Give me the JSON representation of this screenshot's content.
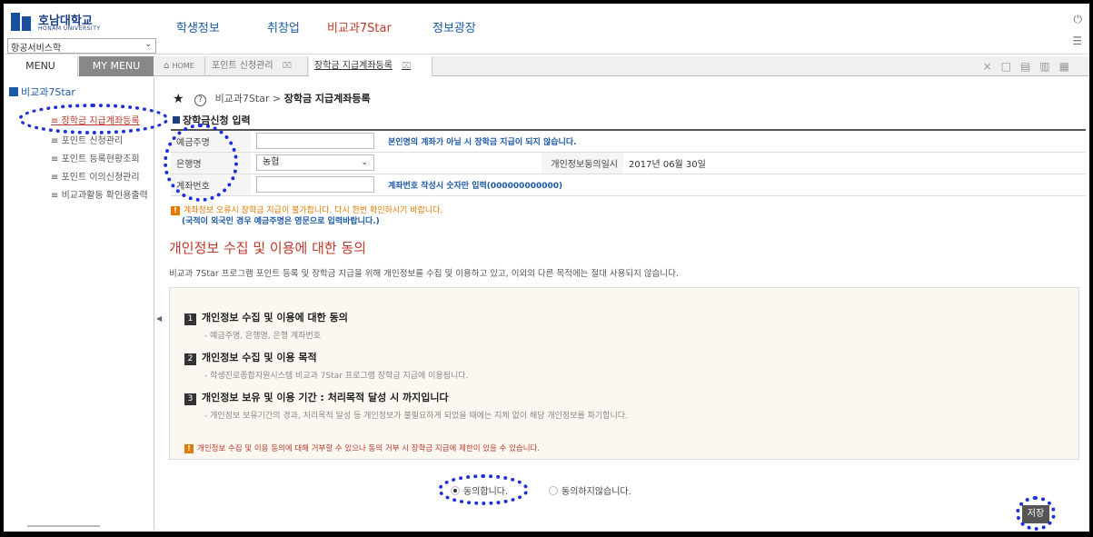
{
  "header": {
    "logo_name": "호남대학교",
    "logo_eng": "HONAM UNIVERSITY",
    "dept_value": "항공서비스학",
    "nav": [
      "학생정보",
      "취창업",
      "비교과7Star",
      "정보광장"
    ]
  },
  "tabs": {
    "menu": "MENU",
    "my_menu": "MY MENU",
    "home": "HOME",
    "tab1": "포인트 신청관리",
    "tab2": "장학금 지급계좌등록"
  },
  "sidebar": {
    "head": "비교과7Star",
    "items": [
      "장학금 지급계좌등록",
      "포인트 신청관리",
      "포인트 등록현황조회",
      "포인트 이의신청관리",
      "비교과활동 확인용출력"
    ]
  },
  "content": {
    "crumb_parent": "비교과7Star",
    "crumb_sep": ">",
    "crumb_current": "장학금 지급계좌등록",
    "section_title": "장학금신청 입력",
    "form": {
      "holder_label": "예금주명",
      "holder_note": "본인명의 계좌가 아닐 시 장학금 지급이 되지 않습니다.",
      "bank_label": "은행명",
      "bank_value": "농협",
      "consent_label": "개인정보동의일시",
      "consent_value": "2017년 06월 30일",
      "account_label": "계좌번호",
      "account_note": "계좌번호 작성시 숫자만 입력(000000000000)"
    },
    "warn1": "계좌정보 오류시 장학금 지급이 불가합니다. 다시 한번 확인하시기 바랍니다.",
    "warn2": "(국적이 외국인 경우 예금주명은 영문으로 입력바랍니다.)",
    "consent_title": "개인정보 수집 및 이용에 대한 동의",
    "consent_desc": "비교과 7Star 프로그램 포인트 등록 및 장학금 지급을 위해 개인정보를 수집 및 이용하고 있고, 이외의 다른 목적에는 절대 사용되지 않습니다.",
    "items": [
      {
        "num": "1",
        "title": "개인정보 수집 및 이용에 대한 동의",
        "desc": "- 예금주명, 은행명, 은행 계좌번호"
      },
      {
        "num": "2",
        "title": "개인정보 수집 및 이용 목적",
        "desc": "- 학생진로종합지원시스템 비교과 7Star 프로그램 장학금 지급에 이용됩니다."
      },
      {
        "num": "3",
        "title": "개인정보 보유 및 이용 기간 : 처리목적 달성 시 까지입니다",
        "desc": "- 개인정보 보유기간의 경과, 처리목적 달성 등 개인정보가 불필요하게 되었을 때에는 지체 없이 해당 개인정보를 파기합니다."
      }
    ],
    "box_warn": "개인정보 수집 및 이용 동의에 대해 거부할 수 있으나 동의 거부 시 장학금 지급에 제한이 있을 수 있습니다.",
    "agree": "동의합니다.",
    "disagree": "동의하지않습니다.",
    "save": "저장"
  }
}
